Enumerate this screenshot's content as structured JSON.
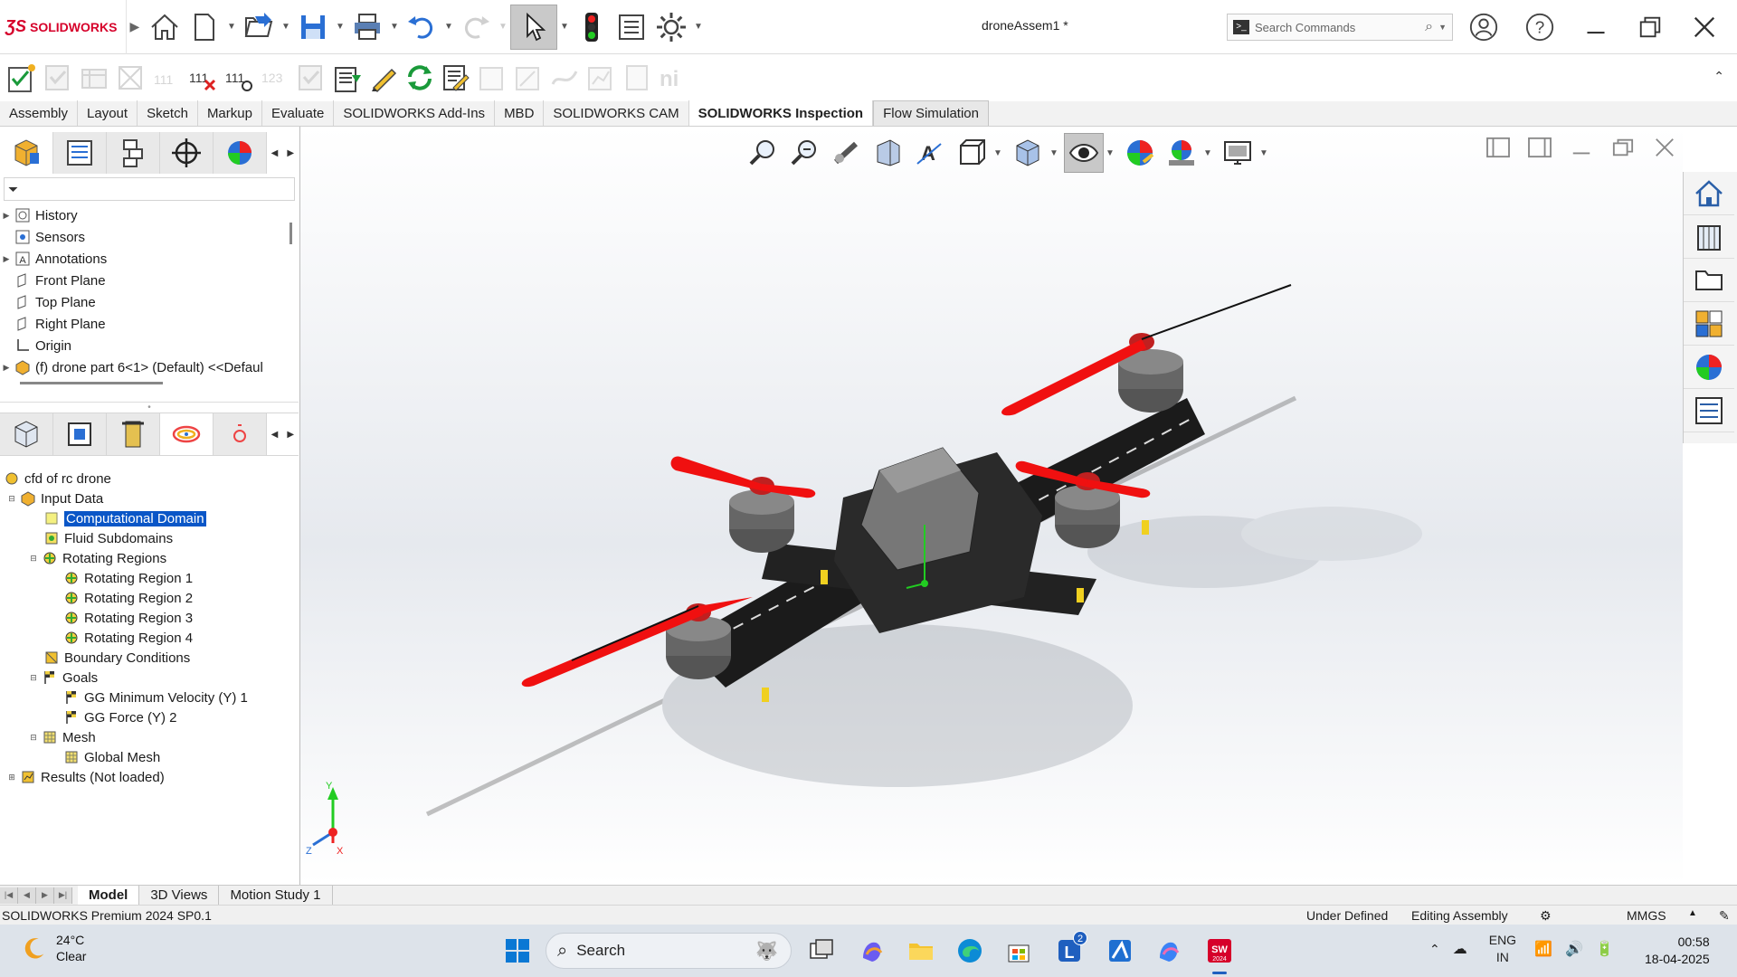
{
  "app": {
    "brand": "SOLIDWORKS",
    "document_title": "droneAssem1 *"
  },
  "search": {
    "placeholder": "Search Commands"
  },
  "tabs": [
    {
      "label": "Assembly"
    },
    {
      "label": "Layout"
    },
    {
      "label": "Sketch"
    },
    {
      "label": "Markup"
    },
    {
      "label": "Evaluate"
    },
    {
      "label": "SOLIDWORKS Add-Ins"
    },
    {
      "label": "MBD"
    },
    {
      "label": "SOLIDWORKS CAM"
    },
    {
      "label": "SOLIDWORKS Inspection"
    },
    {
      "label": "Flow Simulation"
    }
  ],
  "feature_tree": {
    "items": [
      {
        "label": "History",
        "icon": "history-icon"
      },
      {
        "label": "Sensors",
        "icon": "sensor-icon"
      },
      {
        "label": "Annotations",
        "icon": "annotation-icon"
      },
      {
        "label": "Front Plane",
        "icon": "plane-icon"
      },
      {
        "label": "Top Plane",
        "icon": "plane-icon"
      },
      {
        "label": "Right Plane",
        "icon": "plane-icon"
      },
      {
        "label": "Origin",
        "icon": "origin-icon"
      },
      {
        "label": "(f) drone part 6<1> (Default) <<Defaul",
        "icon": "part-icon"
      }
    ]
  },
  "flow_tree": {
    "root": "cfd of rc drone",
    "input_data": "Input Data",
    "computational_domain": "Computational Domain",
    "fluid_subdomains": "Fluid Subdomains",
    "rotating_regions": "Rotating Regions",
    "rotating_items": [
      "Rotating Region 1",
      "Rotating Region 2",
      "Rotating Region 3",
      "Rotating Region 4"
    ],
    "boundary_conditions": "Boundary Conditions",
    "goals": "Goals",
    "goal_items": [
      "GG Minimum Velocity (Y) 1",
      "GG Force (Y) 2"
    ],
    "mesh": "Mesh",
    "global_mesh": "Global Mesh",
    "results": "Results (Not loaded)"
  },
  "bottom_tabs": {
    "model": "Model",
    "views3d": "3D Views",
    "motion": "Motion Study 1"
  },
  "status": {
    "product": "SOLIDWORKS Premium 2024 SP0.1",
    "definition": "Under Defined",
    "mode": "Editing Assembly",
    "units": "MMGS"
  },
  "triad": {
    "y": "Y",
    "z": "Z",
    "x": "X"
  },
  "taskbar": {
    "temperature": "24°C",
    "condition": "Clear",
    "search": "Search",
    "lang1": "ENG",
    "lang2": "IN",
    "time": "00:58",
    "date": "18-04-2025",
    "badge": "2",
    "sw_label": "SW",
    "sw_year": "2024"
  },
  "colors": {
    "selection": "#0a56c7",
    "brand": "#d6002a",
    "propeller": "#f01010"
  }
}
